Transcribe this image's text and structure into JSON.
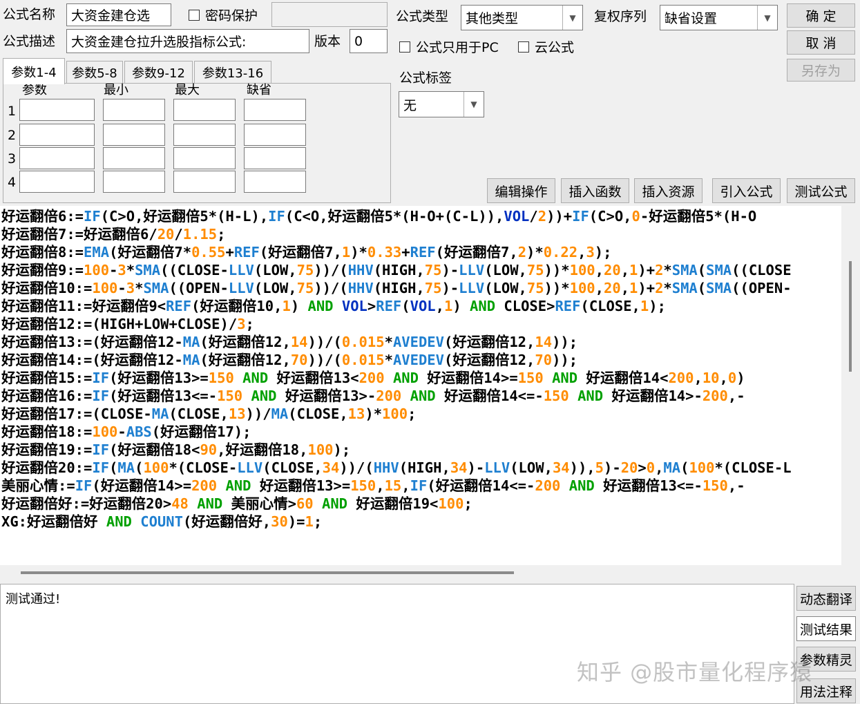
{
  "form": {
    "name_label": "公式名称",
    "name_value": "大资金建仓选",
    "password_label": "密码保护",
    "desc_label": "公式描述",
    "desc_value": "大资金建仓拉升选股指标公式:",
    "version_label": "版本",
    "version_value": "0",
    "type_label": "公式类型",
    "type_value": "其他类型",
    "rights_label": "复权序列",
    "rights_value": "缺省设置",
    "pc_only_label": "公式只用于PC",
    "cloud_label": "云公式",
    "tag_label": "公式标签",
    "tag_value": "无"
  },
  "buttons": {
    "ok": "确 定",
    "cancel": "取 消",
    "save_as": "另存为",
    "edit_ops": "编辑操作",
    "insert_func": "插入函数",
    "insert_res": "插入资源",
    "import_formula": "引入公式",
    "test_formula": "测试公式",
    "dynamic_translate": "动态翻译",
    "test_result": "测试结果",
    "param_wizard": "参数精灵",
    "usage_notes": "用法注释"
  },
  "params": {
    "tabs": [
      "参数1-4",
      "参数5-8",
      "参数9-12",
      "参数13-16"
    ],
    "headers": [
      "参数",
      "最小",
      "最大",
      "缺省"
    ],
    "rows": [
      "1",
      "2",
      "3",
      "4"
    ]
  },
  "code_lines": [
    "好运翻倍6:=IF(C>O,好运翻倍5*(H-L),IF(C<O,好运翻倍5*(H-O+(C-L)),VOL/2))+IF(C>O,0-好运翻倍5*(H-O",
    "好运翻倍7:=好运翻倍6/20/1.15;",
    "好运翻倍8:=EMA(好运翻倍7*0.55+REF(好运翻倍7,1)*0.33+REF(好运翻倍7,2)*0.22,3);",
    "好运翻倍9:=100-3*SMA((CLOSE-LLV(LOW,75))/(HHV(HIGH,75)-LLV(LOW,75))*100,20,1)+2*SMA(SMA((CLOSE",
    "好运翻倍10:=100-3*SMA((OPEN-LLV(LOW,75))/(HHV(HIGH,75)-LLV(LOW,75))*100,20,1)+2*SMA(SMA((OPEN-",
    "好运翻倍11:=好运翻倍9<REF(好运翻倍10,1) AND VOL>REF(VOL,1) AND CLOSE>REF(CLOSE,1);",
    "好运翻倍12:=(HIGH+LOW+CLOSE)/3;",
    "好运翻倍13:=(好运翻倍12-MA(好运翻倍12,14))/(0.015*AVEDEV(好运翻倍12,14));",
    "好运翻倍14:=(好运翻倍12-MA(好运翻倍12,70))/(0.015*AVEDEV(好运翻倍12,70));",
    "好运翻倍15:=IF(好运翻倍13>=150 AND 好运翻倍13<200 AND 好运翻倍14>=150 AND 好运翻倍14<200,10,0)",
    "好运翻倍16:=IF(好运翻倍13<=-150 AND 好运翻倍13>-200 AND 好运翻倍14<=-150 AND 好运翻倍14>-200,-",
    "好运翻倍17:=(CLOSE-MA(CLOSE,13))/MA(CLOSE,13)*100;",
    "好运翻倍18:=100-ABS(好运翻倍17);",
    "好运翻倍19:=IF(好运翻倍18<90,好运翻倍18,100);",
    "好运翻倍20:=IF(MA(100*(CLOSE-LLV(CLOSE,34))/(HHV(HIGH,34)-LLV(LOW,34)),5)-20>0,MA(100*(CLOSE-L",
    "美丽心情:=IF(好运翻倍14>=200 AND 好运翻倍13>=150,15,IF(好运翻倍14<=-200 AND 好运翻倍13<=-150,-",
    "好运翻倍好:=好运翻倍20>48 AND 美丽心情>60 AND 好运翻倍19<100;",
    "XG:好运翻倍好 AND COUNT(好运翻倍好,30)=1;"
  ],
  "output_text": "测试通过!",
  "watermark": "知乎 @股市量化程序猿",
  "colors": {
    "function": "#1e7fd0",
    "number": "#ff8c00",
    "logic": "#00a000",
    "vol": "#0030c0"
  },
  "icons": {
    "combo_arrow": "chevron-down-icon"
  }
}
